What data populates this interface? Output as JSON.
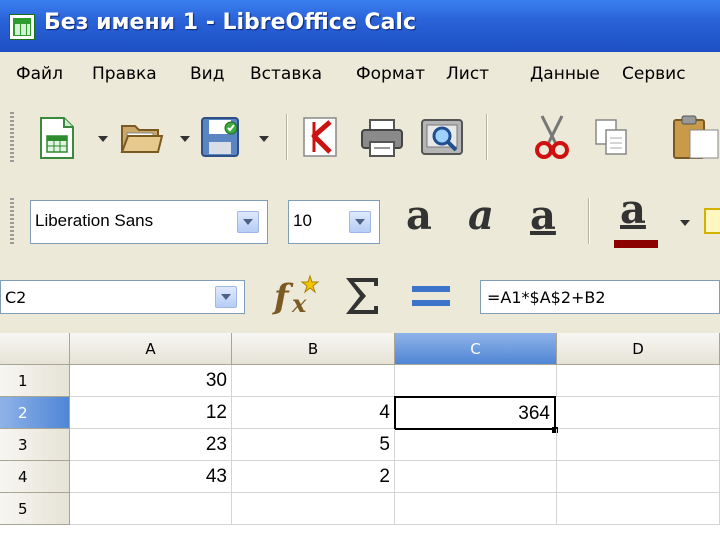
{
  "window": {
    "title": "Без имени 1 - LibreOffice Calc"
  },
  "menu": [
    "Файл",
    "Правка",
    "Вид",
    "Вставка",
    "Формат",
    "Лист",
    "Данные",
    "Сервис"
  ],
  "toolbar_standard": [
    "new-spreadsheet-icon",
    "open-folder-icon",
    "save-icon",
    "export-pdf-icon",
    "print-icon",
    "print-preview-icon",
    "cut-icon",
    "copy-icon",
    "paste-icon"
  ],
  "font": {
    "name": "Liberation Sans",
    "size": "10"
  },
  "formatting": {
    "bold": "a",
    "italic": "a",
    "underline": "a",
    "font_color": "a",
    "font_color_value": "#8b0000"
  },
  "formula_bar": {
    "cell_ref": "C2",
    "formula": "=A1*$A$2+B2"
  },
  "sheet": {
    "columns": [
      "A",
      "B",
      "C",
      "D"
    ],
    "rows": [
      "1",
      "2",
      "3",
      "4",
      "5"
    ],
    "cells": [
      [
        "30",
        "",
        "",
        ""
      ],
      [
        "12",
        "4",
        "364",
        ""
      ],
      [
        "23",
        "5",
        "",
        ""
      ],
      [
        "43",
        "2",
        "",
        ""
      ],
      [
        "",
        "",
        "",
        ""
      ]
    ],
    "selected_cell": "C2",
    "selection_color": "#4f86d6"
  }
}
